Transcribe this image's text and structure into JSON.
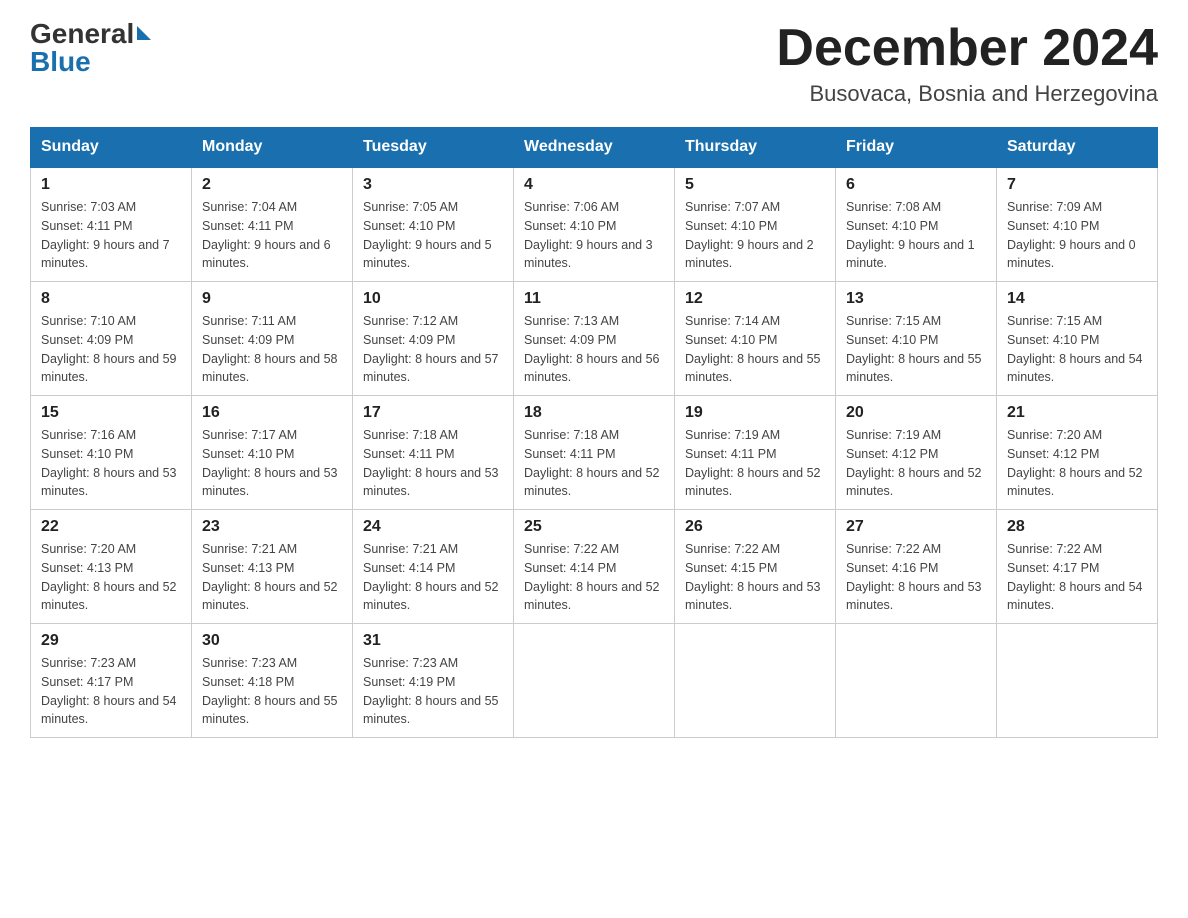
{
  "header": {
    "logo_general": "General",
    "logo_blue": "Blue",
    "month_title": "December 2024",
    "location": "Busovaca, Bosnia and Herzegovina"
  },
  "days_of_week": [
    "Sunday",
    "Monday",
    "Tuesday",
    "Wednesday",
    "Thursday",
    "Friday",
    "Saturday"
  ],
  "weeks": [
    [
      {
        "day": "1",
        "sunrise": "7:03 AM",
        "sunset": "4:11 PM",
        "daylight": "9 hours and 7 minutes."
      },
      {
        "day": "2",
        "sunrise": "7:04 AM",
        "sunset": "4:11 PM",
        "daylight": "9 hours and 6 minutes."
      },
      {
        "day": "3",
        "sunrise": "7:05 AM",
        "sunset": "4:10 PM",
        "daylight": "9 hours and 5 minutes."
      },
      {
        "day": "4",
        "sunrise": "7:06 AM",
        "sunset": "4:10 PM",
        "daylight": "9 hours and 3 minutes."
      },
      {
        "day": "5",
        "sunrise": "7:07 AM",
        "sunset": "4:10 PM",
        "daylight": "9 hours and 2 minutes."
      },
      {
        "day": "6",
        "sunrise": "7:08 AM",
        "sunset": "4:10 PM",
        "daylight": "9 hours and 1 minute."
      },
      {
        "day": "7",
        "sunrise": "7:09 AM",
        "sunset": "4:10 PM",
        "daylight": "9 hours and 0 minutes."
      }
    ],
    [
      {
        "day": "8",
        "sunrise": "7:10 AM",
        "sunset": "4:09 PM",
        "daylight": "8 hours and 59 minutes."
      },
      {
        "day": "9",
        "sunrise": "7:11 AM",
        "sunset": "4:09 PM",
        "daylight": "8 hours and 58 minutes."
      },
      {
        "day": "10",
        "sunrise": "7:12 AM",
        "sunset": "4:09 PM",
        "daylight": "8 hours and 57 minutes."
      },
      {
        "day": "11",
        "sunrise": "7:13 AM",
        "sunset": "4:09 PM",
        "daylight": "8 hours and 56 minutes."
      },
      {
        "day": "12",
        "sunrise": "7:14 AM",
        "sunset": "4:10 PM",
        "daylight": "8 hours and 55 minutes."
      },
      {
        "day": "13",
        "sunrise": "7:15 AM",
        "sunset": "4:10 PM",
        "daylight": "8 hours and 55 minutes."
      },
      {
        "day": "14",
        "sunrise": "7:15 AM",
        "sunset": "4:10 PM",
        "daylight": "8 hours and 54 minutes."
      }
    ],
    [
      {
        "day": "15",
        "sunrise": "7:16 AM",
        "sunset": "4:10 PM",
        "daylight": "8 hours and 53 minutes."
      },
      {
        "day": "16",
        "sunrise": "7:17 AM",
        "sunset": "4:10 PM",
        "daylight": "8 hours and 53 minutes."
      },
      {
        "day": "17",
        "sunrise": "7:18 AM",
        "sunset": "4:11 PM",
        "daylight": "8 hours and 53 minutes."
      },
      {
        "day": "18",
        "sunrise": "7:18 AM",
        "sunset": "4:11 PM",
        "daylight": "8 hours and 52 minutes."
      },
      {
        "day": "19",
        "sunrise": "7:19 AM",
        "sunset": "4:11 PM",
        "daylight": "8 hours and 52 minutes."
      },
      {
        "day": "20",
        "sunrise": "7:19 AM",
        "sunset": "4:12 PM",
        "daylight": "8 hours and 52 minutes."
      },
      {
        "day": "21",
        "sunrise": "7:20 AM",
        "sunset": "4:12 PM",
        "daylight": "8 hours and 52 minutes."
      }
    ],
    [
      {
        "day": "22",
        "sunrise": "7:20 AM",
        "sunset": "4:13 PM",
        "daylight": "8 hours and 52 minutes."
      },
      {
        "day": "23",
        "sunrise": "7:21 AM",
        "sunset": "4:13 PM",
        "daylight": "8 hours and 52 minutes."
      },
      {
        "day": "24",
        "sunrise": "7:21 AM",
        "sunset": "4:14 PM",
        "daylight": "8 hours and 52 minutes."
      },
      {
        "day": "25",
        "sunrise": "7:22 AM",
        "sunset": "4:14 PM",
        "daylight": "8 hours and 52 minutes."
      },
      {
        "day": "26",
        "sunrise": "7:22 AM",
        "sunset": "4:15 PM",
        "daylight": "8 hours and 53 minutes."
      },
      {
        "day": "27",
        "sunrise": "7:22 AM",
        "sunset": "4:16 PM",
        "daylight": "8 hours and 53 minutes."
      },
      {
        "day": "28",
        "sunrise": "7:22 AM",
        "sunset": "4:17 PM",
        "daylight": "8 hours and 54 minutes."
      }
    ],
    [
      {
        "day": "29",
        "sunrise": "7:23 AM",
        "sunset": "4:17 PM",
        "daylight": "8 hours and 54 minutes."
      },
      {
        "day": "30",
        "sunrise": "7:23 AM",
        "sunset": "4:18 PM",
        "daylight": "8 hours and 55 minutes."
      },
      {
        "day": "31",
        "sunrise": "7:23 AM",
        "sunset": "4:19 PM",
        "daylight": "8 hours and 55 minutes."
      },
      null,
      null,
      null,
      null
    ]
  ],
  "labels": {
    "sunrise": "Sunrise:",
    "sunset": "Sunset:",
    "daylight": "Daylight:"
  }
}
